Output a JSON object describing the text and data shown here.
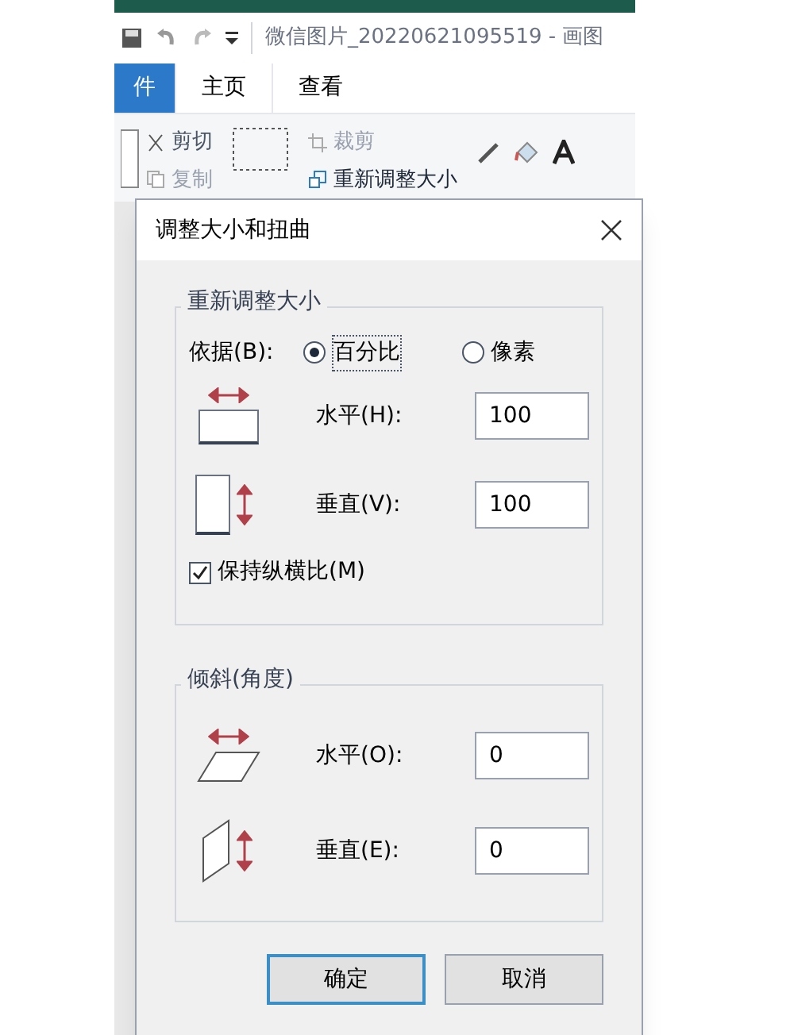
{
  "window": {
    "title": "微信图片_20220621095519 - 画图"
  },
  "ribbon_tabs": [
    {
      "label": "件",
      "kind": "file",
      "selected": false
    },
    {
      "label": "主页",
      "kind": "tab",
      "selected": true
    },
    {
      "label": "查看",
      "kind": "tab",
      "selected": false
    }
  ],
  "ribbon": {
    "cut": "剪切",
    "copy": "复制",
    "crop": "裁剪",
    "resize": "重新调整大小"
  },
  "dialog": {
    "title": "调整大小和扭曲",
    "resize": {
      "title": "重新调整大小",
      "by_label": "依据(B):",
      "options": [
        {
          "label": "百分比",
          "selected": true
        },
        {
          "label": "像素",
          "selected": false
        }
      ],
      "fields": [
        {
          "label": "水平(H):",
          "value": "100",
          "kind": "horizontal"
        },
        {
          "label": "垂直(V):",
          "value": "100",
          "kind": "vertical"
        }
      ],
      "keep_ratio": {
        "label": "保持纵横比(M)",
        "checked": true
      }
    },
    "skew": {
      "title": "倾斜(角度)",
      "fields": [
        {
          "label": "水平(O):",
          "value": "0",
          "kind": "horizontal"
        },
        {
          "label": "垂直(E):",
          "value": "0",
          "kind": "vertical"
        }
      ]
    },
    "buttons": [
      {
        "label": "确定",
        "kind": "default"
      },
      {
        "label": "取消",
        "kind": "normal"
      }
    ]
  }
}
